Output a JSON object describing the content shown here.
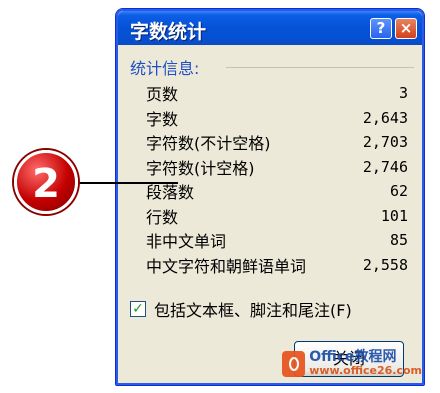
{
  "dialog": {
    "title": "字数统计",
    "help_glyph": "?",
    "close_glyph": "×"
  },
  "stats": {
    "section_label": "统计信息:",
    "rows": [
      {
        "label": "页数",
        "value": "3"
      },
      {
        "label": "字数",
        "value": "2,643"
      },
      {
        "label": "字符数(不计空格)",
        "value": "2,703"
      },
      {
        "label": "字符数(计空格)",
        "value": "2,746"
      },
      {
        "label": "段落数",
        "value": "62"
      },
      {
        "label": "行数",
        "value": "101"
      },
      {
        "label": "非中文单词",
        "value": "85"
      },
      {
        "label": "中文字符和朝鲜语单词",
        "value": "2,558"
      }
    ]
  },
  "include_textboxes": {
    "label": "包括文本框、脚注和尾注(F)",
    "checked": true,
    "check_glyph": "✓"
  },
  "close_button": {
    "label": "关闭"
  },
  "callout": {
    "number": "2"
  },
  "watermark": {
    "line1": "Office教程网",
    "line2": "www.office26.com"
  },
  "colors": {
    "titlebar": "#0653d8",
    "dialog_bg": "#ece9d8",
    "section_label": "#1f4fc7",
    "callout": "#c40000"
  }
}
